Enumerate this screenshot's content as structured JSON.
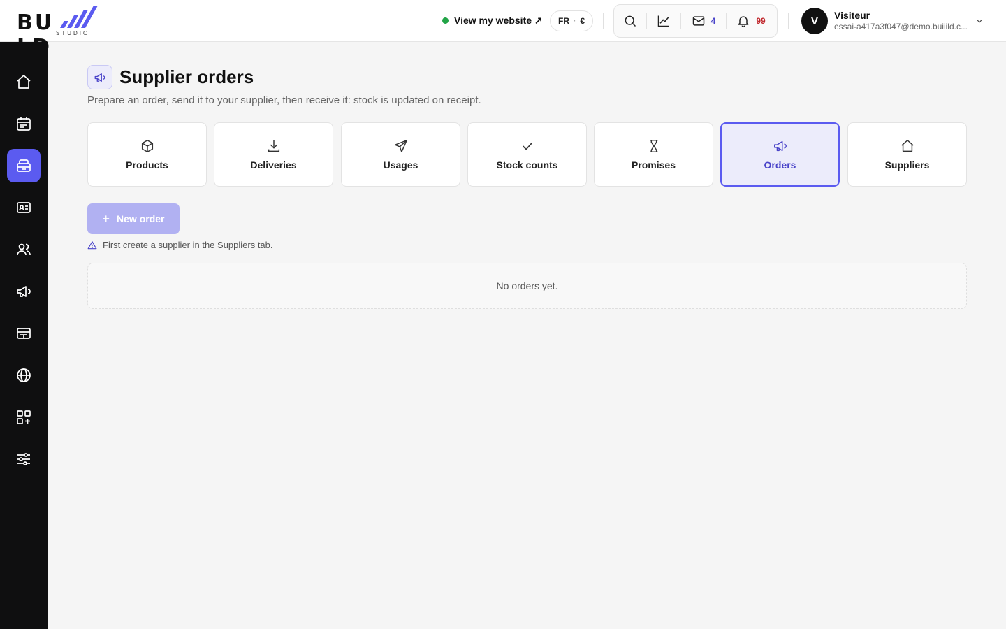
{
  "brand": {
    "logo_text_left": "BU",
    "logo_text_right": "LD",
    "logo_sub": "STUDIO",
    "accent": "#5b5bf0"
  },
  "header": {
    "site_link": "View my website ↗",
    "lang": "FR",
    "currency": "€",
    "tools": [
      {
        "icon": "search-icon"
      },
      {
        "icon": "chart-line-icon"
      },
      {
        "icon": "mail-icon",
        "badge": "4",
        "badge_color": "#4a44c9"
      },
      {
        "icon": "bell-icon",
        "badge": "99",
        "badge_color": "#c0262b"
      }
    ],
    "user": {
      "initial": "V",
      "name": "Visiteur",
      "email": "essai-a417a3f047@demo.buiiild.c..."
    }
  },
  "sidebar": {
    "items": [
      {
        "icon": "home-icon"
      },
      {
        "icon": "calendar-icon"
      },
      {
        "icon": "inventory-icon",
        "active": true
      },
      {
        "icon": "contact-card-icon"
      },
      {
        "icon": "users-icon"
      },
      {
        "icon": "megaphone-icon"
      },
      {
        "icon": "payment-icon"
      },
      {
        "icon": "globe-icon"
      },
      {
        "icon": "apps-add-icon"
      },
      {
        "icon": "settings-sliders-icon"
      }
    ]
  },
  "page": {
    "title": "Supplier orders",
    "subtitle": "Prepare an order, send it to your supplier, then receive it: stock is updated on receipt.",
    "tabs": [
      {
        "label": "Products",
        "icon": "box-icon"
      },
      {
        "label": "Deliveries",
        "icon": "download-icon"
      },
      {
        "label": "Usages",
        "icon": "send-icon"
      },
      {
        "label": "Stock counts",
        "icon": "check-icon"
      },
      {
        "label": "Promises",
        "icon": "hourglass-icon"
      },
      {
        "label": "Orders",
        "icon": "megaphone-icon",
        "active": true
      },
      {
        "label": "Suppliers",
        "icon": "home-icon"
      }
    ],
    "new_order_label": "New order",
    "warning": "First create a supplier in the Suppliers tab.",
    "empty_text": "No orders yet."
  }
}
